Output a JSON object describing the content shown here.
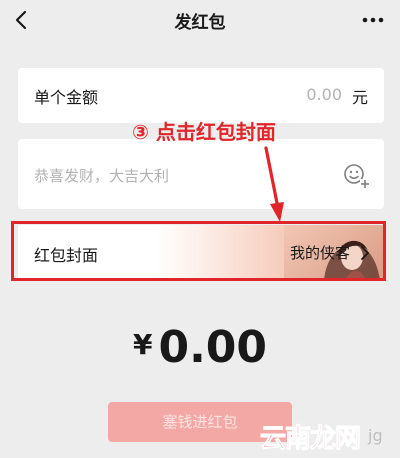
{
  "header": {
    "title": "发红包",
    "back_icon": "chevron-left-icon",
    "more_icon": "more-dots-icon"
  },
  "amount": {
    "label": "单个金额",
    "value": "0.00",
    "unit": "元"
  },
  "greeting": {
    "placeholder": "恭喜发财，大吉大利",
    "emoji_icon": "emoji-add-icon"
  },
  "cover": {
    "label": "红包封面",
    "selected": "我的侠客",
    "chevron_icon": "chevron-right-icon"
  },
  "annotation": {
    "text": "③ 点击红包封面",
    "color": "#e0262b"
  },
  "total": {
    "currency": "¥",
    "amount": "0.00"
  },
  "submit": {
    "label": "塞钱进红包",
    "color": "#f3a8a5"
  },
  "watermark": {
    "text": "云南龙网",
    "sub": "jg"
  }
}
